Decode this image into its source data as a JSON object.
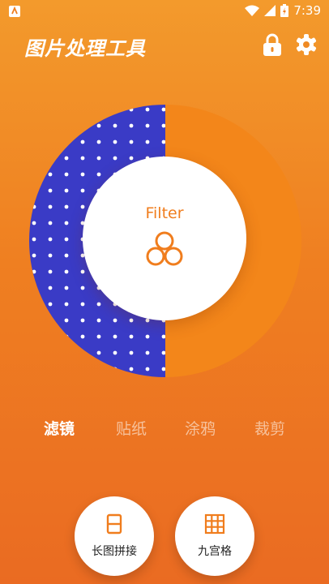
{
  "status_bar": {
    "time": "7:39",
    "icons": [
      "app-indicator-icon",
      "wifi-icon",
      "signal-icon",
      "battery-icon"
    ]
  },
  "header": {
    "title": "图片处理工具",
    "icons": [
      "lock-icon",
      "gear-icon"
    ]
  },
  "dial": {
    "center_label": "Filter",
    "center_icon": "filter-circles-icon",
    "accent": "#f08a12",
    "pattern_color": "#3c3cc4"
  },
  "tabs": [
    {
      "label": "滤镜",
      "active": true
    },
    {
      "label": "贴纸",
      "active": false
    },
    {
      "label": "涂鸦",
      "active": false
    },
    {
      "label": "裁剪",
      "active": false
    }
  ],
  "tools": [
    {
      "label": "长图拼接",
      "icon": "long-image-icon"
    },
    {
      "label": "九宫格",
      "icon": "grid-icon"
    }
  ]
}
